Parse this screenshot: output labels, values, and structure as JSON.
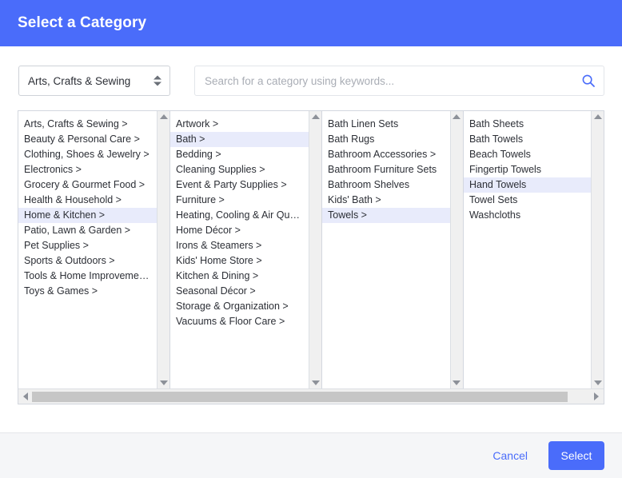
{
  "header": {
    "title": "Select a Category"
  },
  "controls": {
    "category_select": {
      "value": "Arts, Crafts & Sewing",
      "stepper_up_icon": "triangle-up-icon",
      "stepper_down_icon": "triangle-down-icon"
    },
    "search": {
      "value": "",
      "placeholder": "Search for a category using keywords...",
      "icon": "search-icon"
    }
  },
  "columns": [
    {
      "index": 0,
      "items": [
        {
          "label": "Arts, Crafts & Sewing >",
          "selected": false
        },
        {
          "label": "Beauty & Personal Care >",
          "selected": false
        },
        {
          "label": "Clothing, Shoes & Jewelry >",
          "selected": false
        },
        {
          "label": "Electronics >",
          "selected": false
        },
        {
          "label": "Grocery & Gourmet Food >",
          "selected": false
        },
        {
          "label": "Health & Household >",
          "selected": false
        },
        {
          "label": "Home & Kitchen >",
          "selected": true
        },
        {
          "label": "Patio, Lawn & Garden >",
          "selected": false
        },
        {
          "label": "Pet Supplies >",
          "selected": false
        },
        {
          "label": "Sports & Outdoors >",
          "selected": false
        },
        {
          "label": "Tools & Home Improvement >",
          "selected": false
        },
        {
          "label": "Toys & Games >",
          "selected": false
        }
      ]
    },
    {
      "index": 1,
      "items": [
        {
          "label": "Artwork >",
          "selected": false
        },
        {
          "label": "Bath >",
          "selected": true
        },
        {
          "label": "Bedding >",
          "selected": false
        },
        {
          "label": "Cleaning Supplies >",
          "selected": false
        },
        {
          "label": "Event & Party Supplies >",
          "selected": false
        },
        {
          "label": "Furniture >",
          "selected": false
        },
        {
          "label": "Heating, Cooling & Air Quali…",
          "selected": false
        },
        {
          "label": "Home Décor >",
          "selected": false
        },
        {
          "label": "Irons & Steamers >",
          "selected": false
        },
        {
          "label": "Kids' Home Store >",
          "selected": false
        },
        {
          "label": "Kitchen & Dining >",
          "selected": false
        },
        {
          "label": "Seasonal Décor >",
          "selected": false
        },
        {
          "label": "Storage & Organization >",
          "selected": false
        },
        {
          "label": "Vacuums & Floor Care >",
          "selected": false
        }
      ]
    },
    {
      "index": 2,
      "items": [
        {
          "label": "Bath Linen Sets",
          "selected": false
        },
        {
          "label": "Bath Rugs",
          "selected": false
        },
        {
          "label": "Bathroom Accessories >",
          "selected": false
        },
        {
          "label": "Bathroom Furniture Sets",
          "selected": false
        },
        {
          "label": "Bathroom Shelves",
          "selected": false
        },
        {
          "label": "Kids' Bath >",
          "selected": false
        },
        {
          "label": "Towels >",
          "selected": true
        }
      ]
    },
    {
      "index": 3,
      "items": [
        {
          "label": "Bath Sheets",
          "selected": false
        },
        {
          "label": "Bath Towels",
          "selected": false
        },
        {
          "label": "Beach Towels",
          "selected": false
        },
        {
          "label": "Fingertip Towels",
          "selected": false
        },
        {
          "label": "Hand Towels",
          "selected": true
        },
        {
          "label": "Towel Sets",
          "selected": false
        },
        {
          "label": "Washcloths",
          "selected": false
        }
      ]
    }
  ],
  "scrollbars": {
    "vertical_up_icon": "scroll-up-arrow-icon",
    "vertical_down_icon": "scroll-down-arrow-icon",
    "horizontal_left_icon": "scroll-left-arrow-icon",
    "horizontal_right_icon": "scroll-right-arrow-icon"
  },
  "footer": {
    "cancel_label": "Cancel",
    "select_label": "Select"
  },
  "colors": {
    "accent": "#4a6cfa",
    "selected_row": "#e8ebfb",
    "footer_bg": "#f5f6f8",
    "panel_border": "#d3d7df",
    "text": "#2c2f36",
    "placeholder": "#a9adb5"
  }
}
